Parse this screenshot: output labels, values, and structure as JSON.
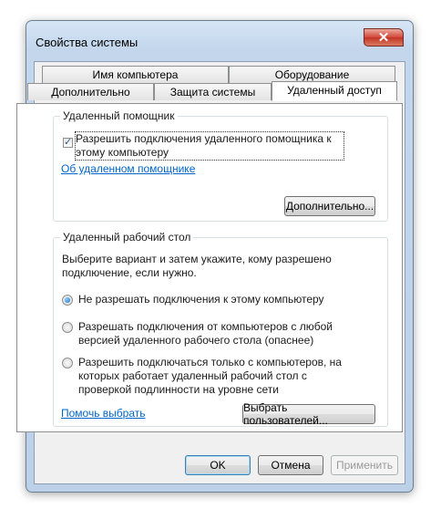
{
  "window": {
    "title": "Свойства системы",
    "close_glyph": "✕"
  },
  "tabs": {
    "row_top": [
      "Имя компьютера",
      "Оборудование"
    ],
    "row_bottom": [
      "Дополнительно",
      "Защита системы",
      "Удаленный доступ"
    ],
    "active": "Удаленный доступ"
  },
  "remote_assistance": {
    "group_title": "Удаленный помощник",
    "checkbox_label": "Разрешить подключения удаленного помощника к этому компьютеру",
    "checkbox_checked": true,
    "checkbox_glyph": "✓",
    "link": "Об удаленном помощнике",
    "advanced_button": "Дополнительно..."
  },
  "remote_desktop": {
    "group_title": "Удаленный рабочий стол",
    "description": "Выберите вариант и затем укажите, кому разрешено подключение, если нужно.",
    "options": [
      {
        "label": "Не разрешать подключения к этому компьютеру",
        "selected": true
      },
      {
        "label": "Разрешать подключения от компьютеров с любой версией удаленного рабочего стола (опаснее)",
        "selected": false
      },
      {
        "label": "Разрешить подключаться только с компьютеров, на которых работает удаленный рабочий стол с проверкой подлинности на уровне сети",
        "selected": false
      }
    ],
    "help_link": "Помочь выбрать",
    "select_users_button": "Выбрать пользователей..."
  },
  "footer": {
    "ok": "OK",
    "cancel": "Отмена",
    "apply": "Применить"
  },
  "colors": {
    "accent": "#3c7fb1",
    "link": "#0066cc",
    "close": "#c23424"
  }
}
